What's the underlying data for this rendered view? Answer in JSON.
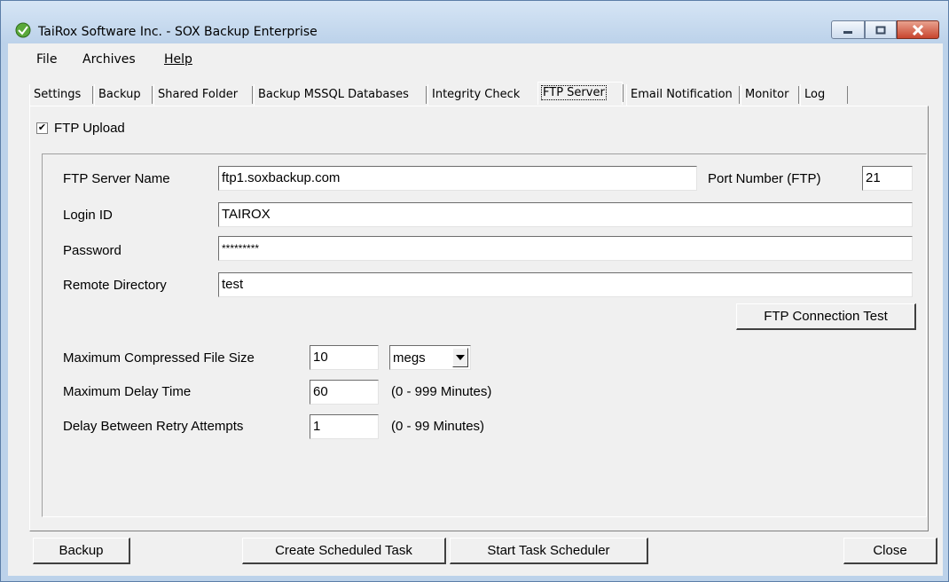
{
  "window": {
    "title": "TaiRox Software Inc. - SOX Backup Enterprise",
    "icon": "tairox-app-icon"
  },
  "menu": [
    "File",
    "Archives",
    "Help"
  ],
  "tabs": [
    "Settings",
    "Backup",
    "Shared Folder",
    "Backup MSSQL Databases",
    "Integrity Check",
    "FTP Server",
    "Email Notification",
    "Monitor",
    "Log"
  ],
  "active_tab": "FTP Server",
  "ftp_upload": {
    "label": "FTP Upload",
    "checked": true,
    "check_glyph": "✔"
  },
  "form": {
    "server_label": "FTP Server Name",
    "server_value": "ftp1.soxbackup.com",
    "port_label": "Port Number (FTP)",
    "port_value": "21",
    "login_label": "Login ID",
    "login_value": "TAIROX",
    "password_label": "Password",
    "password_value": "*********",
    "remote_label": "Remote Directory",
    "remote_value": "test",
    "test_button": "FTP Connection Test",
    "max_size_label": "Maximum Compressed File Size",
    "max_size_value": "10",
    "size_unit": "megs",
    "max_delay_label": "Maximum Delay Time",
    "max_delay_value": "60",
    "max_delay_hint": "(0 - 999 Minutes)",
    "retry_label": "Delay Between Retry Attempts",
    "retry_value": "1",
    "retry_hint": "(0 - 99 Minutes)"
  },
  "footer": {
    "backup": "Backup",
    "create_task": "Create Scheduled Task",
    "start_scheduler": "Start Task Scheduler",
    "close": "Close"
  },
  "colors": {
    "titlebar": "#bcd2ea",
    "client": "#f0f0f0",
    "close_button": "#c8452e"
  }
}
